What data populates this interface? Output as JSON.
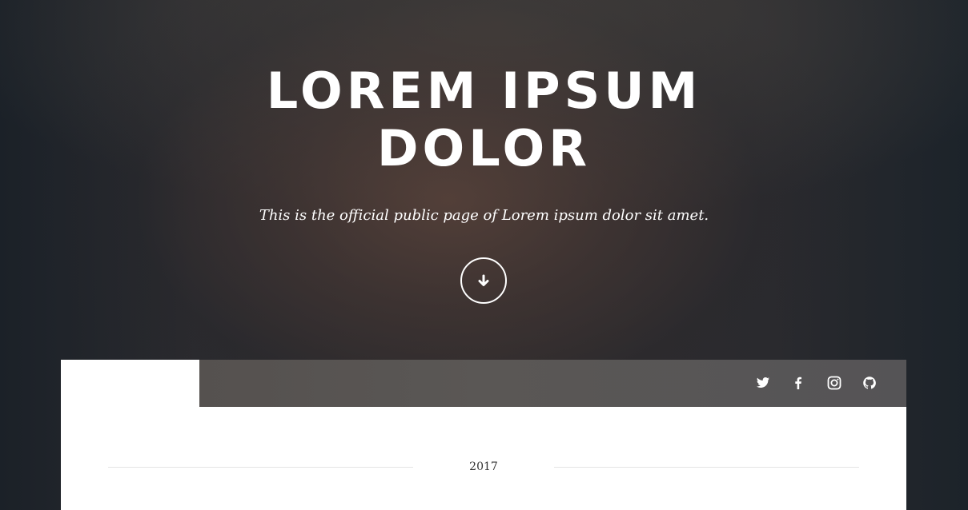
{
  "hero": {
    "title_line1": "LOREM IPSUM",
    "title_line2": "DOLOR",
    "subtitle": "This is the official public page of Lorem ipsum dolor sit amet.",
    "scroll_icon": "arrow-down-icon"
  },
  "social": {
    "icons": [
      "twitter-icon",
      "facebook-icon",
      "instagram-icon",
      "github-icon"
    ]
  },
  "timeline": {
    "year": "2017"
  }
}
